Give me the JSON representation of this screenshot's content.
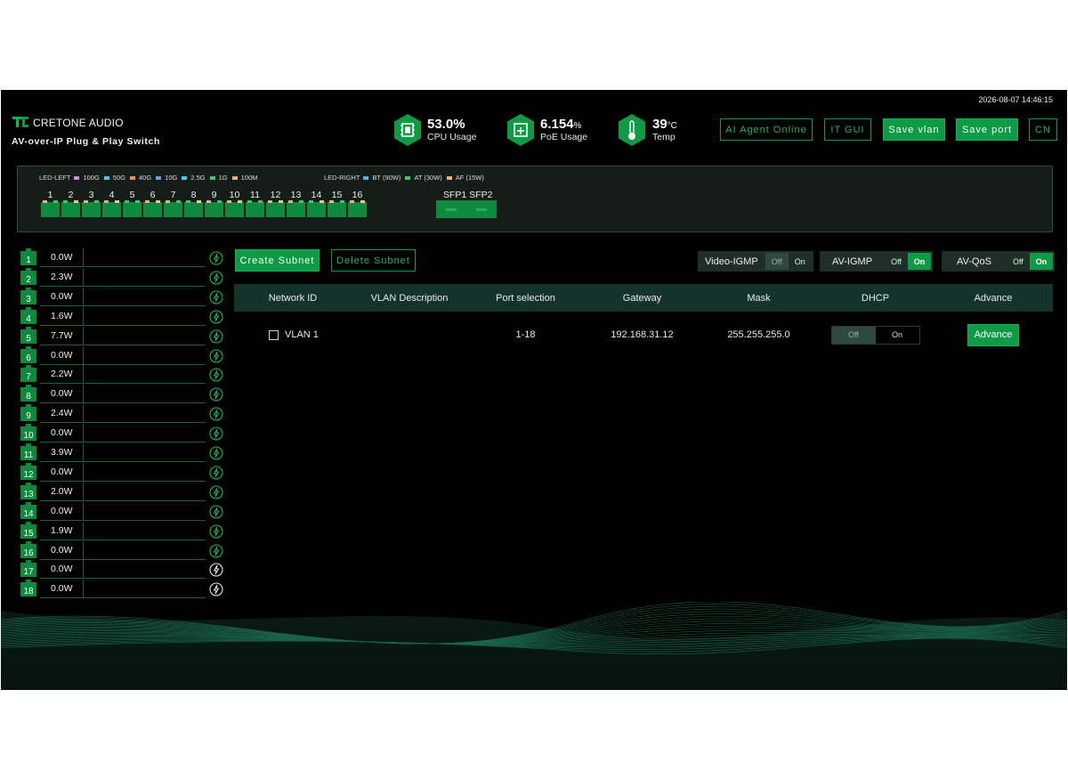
{
  "header": {
    "datetime": "2026-08-07 14:46:15",
    "brand_name": "CRETONE AUDIO",
    "brand_sub": "AV-over-IP Plug & Play Switch",
    "stats": [
      {
        "value": "53.0%",
        "unit": "",
        "label": "CPU Usage",
        "icon": "cpu-icon"
      },
      {
        "value": "6.154",
        "unit": "%",
        "label": "PoE Usage",
        "icon": "poe-icon"
      },
      {
        "value": "39",
        "unit": "°C",
        "label": "Temp",
        "icon": "thermometer-icon"
      }
    ],
    "buttons": {
      "ai_agent": "AI Agent Online",
      "it_gui": "IT GUI",
      "save_vlan": "Save vlan",
      "save_port": "Save port",
      "lang": "CN"
    }
  },
  "legend": {
    "left_title": "LED-LEFT",
    "left": [
      {
        "label": "100G",
        "color": "#d887e8"
      },
      {
        "label": "50G",
        "color": "#46c8f0"
      },
      {
        "label": "40G",
        "color": "#ff8a5a"
      },
      {
        "label": "10G",
        "color": "#6a9cf5"
      },
      {
        "label": "2.5G",
        "color": "#3fd0e0"
      },
      {
        "label": "1G",
        "color": "#3ec96a"
      },
      {
        "label": "100M",
        "color": "#f0b07a"
      }
    ],
    "right_title": "LED-RIGHT",
    "right": [
      {
        "label": "BT (90W)",
        "color": "#46b8f0"
      },
      {
        "label": "AT (30W)",
        "color": "#3ec96a"
      },
      {
        "label": "AF (15W)",
        "color": "#f0b07a"
      }
    ]
  },
  "ports_panel": {
    "numbers": [
      "1",
      "2",
      "3",
      "4",
      "5",
      "6",
      "7",
      "8",
      "9",
      "10",
      "11",
      "12",
      "13",
      "14",
      "15",
      "16"
    ],
    "sfp_labels": [
      "SFP1",
      "SFP2"
    ]
  },
  "power_list": [
    {
      "port": "1",
      "power": "0.0W",
      "poe": true
    },
    {
      "port": "2",
      "power": "2.3W",
      "poe": true
    },
    {
      "port": "3",
      "power": "0.0W",
      "poe": true
    },
    {
      "port": "4",
      "power": "1.6W",
      "poe": true
    },
    {
      "port": "5",
      "power": "7.7W",
      "poe": true
    },
    {
      "port": "6",
      "power": "0.0W",
      "poe": true
    },
    {
      "port": "7",
      "power": "2.2W",
      "poe": true
    },
    {
      "port": "8",
      "power": "0.0W",
      "poe": true
    },
    {
      "port": "9",
      "power": "2.4W",
      "poe": true
    },
    {
      "port": "10",
      "power": "0.0W",
      "poe": true
    },
    {
      "port": "11",
      "power": "3.9W",
      "poe": true
    },
    {
      "port": "12",
      "power": "0.0W",
      "poe": true
    },
    {
      "port": "13",
      "power": "2.0W",
      "poe": true
    },
    {
      "port": "14",
      "power": "0.0W",
      "poe": true
    },
    {
      "port": "15",
      "power": "1.9W",
      "poe": true
    },
    {
      "port": "16",
      "power": "0.0W",
      "poe": true
    },
    {
      "port": "17",
      "power": "0.0W",
      "poe": false
    },
    {
      "port": "18",
      "power": "0.0W",
      "poe": false
    }
  ],
  "subnet": {
    "create": "Create Subnet",
    "delete": "Delete Subnet"
  },
  "toggles": [
    {
      "label": "Video-IGMP",
      "off": "Off",
      "on": "On",
      "state": "off"
    },
    {
      "label": "AV-IGMP",
      "off": "Off",
      "on": "On",
      "state": "on"
    },
    {
      "label": "AV-QoS",
      "off": "Off",
      "on": "On",
      "state": "on"
    }
  ],
  "table": {
    "headers": [
      "Network ID",
      "VLAN Description",
      "Port selection",
      "Gateway",
      "Mask",
      "DHCP",
      "Advance"
    ],
    "rows": [
      {
        "network_id": "VLAN 1",
        "description": "",
        "ports": "1-18",
        "gateway": "192.168.31.12",
        "mask": "255.255.255.0",
        "dhcp_off": "Off",
        "dhcp_on": "On",
        "dhcp_state": "off",
        "advance": "Advance"
      }
    ]
  },
  "colors": {
    "accent": "#0f9a46",
    "background": "#000000",
    "panel": "#161d19"
  }
}
